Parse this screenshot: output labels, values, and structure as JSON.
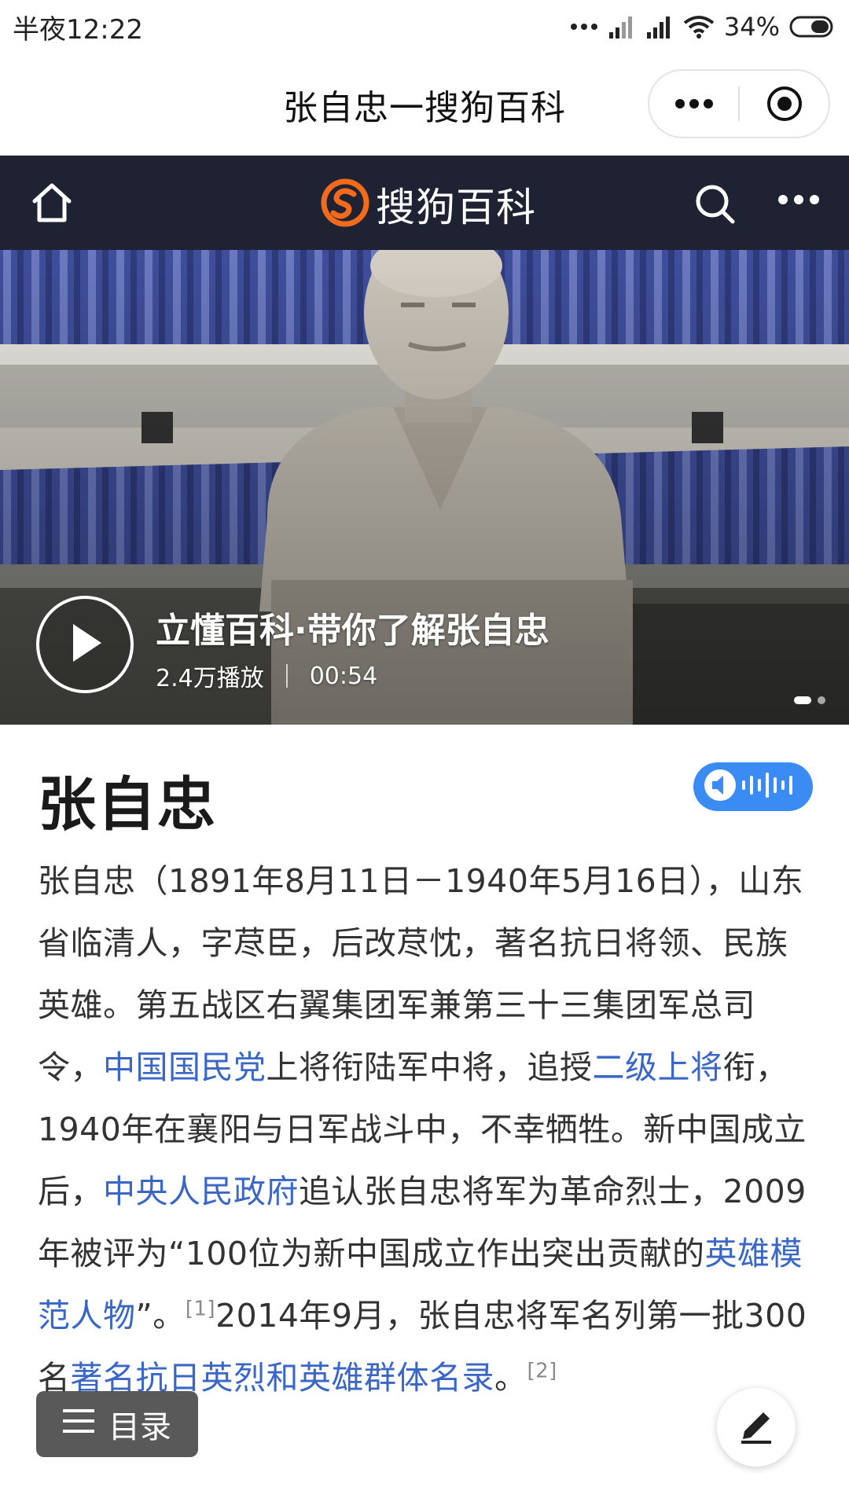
{
  "status_bar": {
    "time": "半夜12:22",
    "battery": "34%",
    "icons": [
      "dots-icon",
      "signal-icon",
      "signal-icon-2",
      "wifi-icon",
      "battery-icon"
    ]
  },
  "title_bar": {
    "title": "张自忠一搜狗百科",
    "capsule_icons": [
      "more-dots-icon",
      "close-target-icon"
    ]
  },
  "app_header": {
    "brand": "搜狗百科",
    "icons": [
      "home-icon",
      "sogou-logo-icon",
      "search-icon",
      "more-icon"
    ]
  },
  "hero": {
    "video_title": "立懂百科·带你了解张自忠",
    "plays": "2.4万播放",
    "duration": "00:54",
    "slide_count": 2,
    "active_slide": 1
  },
  "article": {
    "title": "张自忠",
    "summary_parts": [
      {
        "t": "text",
        "v": "张自忠（1891年8月11日－1940年5月16日），山东省临清人，字荩臣，后改荩忱，著名抗日将领、民族英雄。第五战区右翼集团军兼第三十三集团军总司令，"
      },
      {
        "t": "link",
        "v": "中国国民党"
      },
      {
        "t": "text",
        "v": "上将衔陆军中将，追授"
      },
      {
        "t": "link",
        "v": "二级上将"
      },
      {
        "t": "text",
        "v": "衔，1940年在襄阳与日军战斗中，不幸牺牲。新中国成立后，"
      },
      {
        "t": "link",
        "v": "中央人民政府"
      },
      {
        "t": "text",
        "v": "追认张自忠将军为革命烈士，2009年被评为“100位为新中国成立作出突出贡献的"
      },
      {
        "t": "link",
        "v": "英雄模范人物"
      },
      {
        "t": "text",
        "v": "”。"
      },
      {
        "t": "ref",
        "v": "[1]"
      },
      {
        "t": "text",
        "v": "2014年9月，张自忠将军名列第一批300名"
      },
      {
        "t": "link",
        "v": "著名抗日英烈和英雄群体名录"
      },
      {
        "t": "text",
        "v": "。"
      },
      {
        "t": "ref",
        "v": "[2]"
      }
    ]
  },
  "floating": {
    "toc_label": "目录",
    "toc_icon": "menu-lines-icon",
    "edit_icon": "pencil-icon"
  },
  "colors": {
    "header_bg": "#1f2233",
    "link": "#3a67c5",
    "audio_button": "#3b8bf5",
    "brand_orange": "#f26a1b"
  }
}
